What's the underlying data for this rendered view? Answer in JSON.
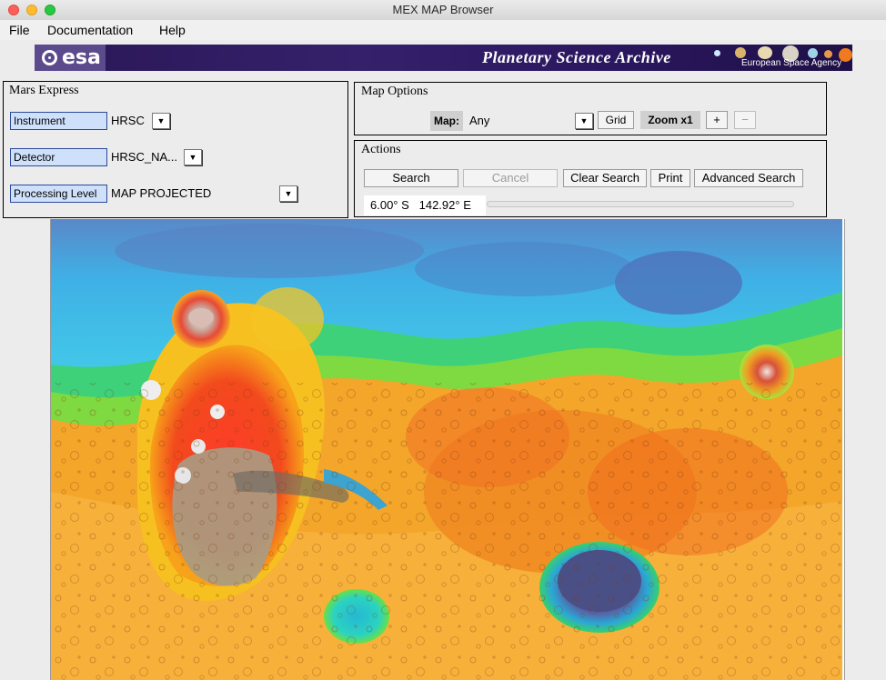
{
  "window": {
    "title": "MEX MAP Browser"
  },
  "menu": {
    "file": "File",
    "documentation": "Documentation",
    "help": "Help"
  },
  "banner": {
    "logo_text": "esa",
    "title": "Planetary Science  Archive",
    "agency": "European Space Agency"
  },
  "mission_panel": {
    "title": "Mars Express",
    "instrument_label": "Instrument",
    "instrument_value": "HRSC",
    "detector_label": "Detector",
    "detector_value": "HRSC_NA...",
    "processing_label": "Processing Level",
    "processing_value": "MAP PROJECTED"
  },
  "map_options": {
    "title": "Map Options",
    "map_label": "Map:",
    "map_value": "Any",
    "grid_label": "Grid",
    "zoom_label": "Zoom x1",
    "zoom_in": "+",
    "zoom_out": "−"
  },
  "actions": {
    "title": "Actions",
    "search": "Search",
    "cancel": "Cancel",
    "clear_search": "Clear Search",
    "print": "Print",
    "advanced_search": "Advanced Search",
    "coordinates": "6.00° S   142.92° E",
    "progress": 0
  },
  "colors": {
    "label_bg": "#cfe0fb",
    "label_border": "#2a4a9a",
    "banner_bg": "#2e1a62",
    "progress": "#3b82f0"
  }
}
